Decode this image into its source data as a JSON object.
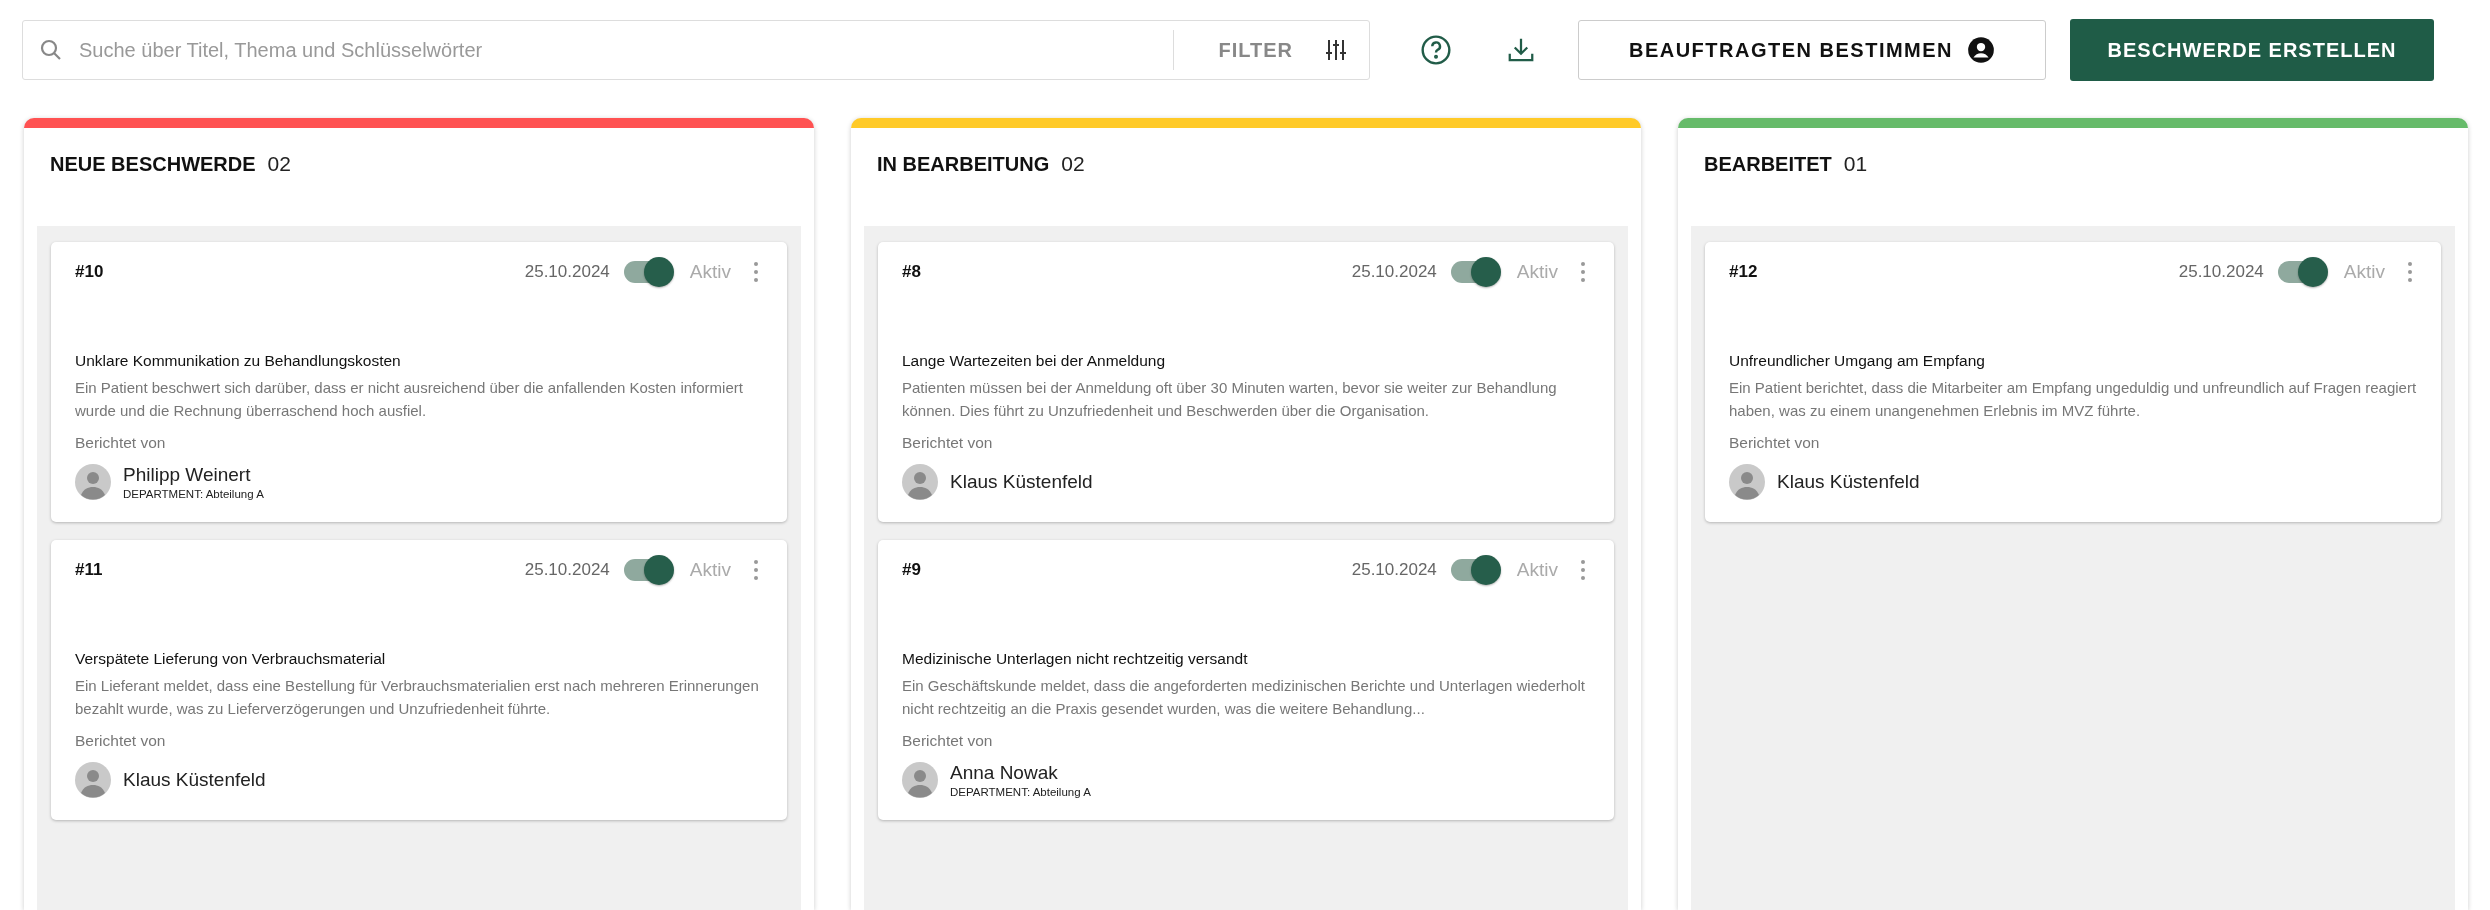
{
  "toolbar": {
    "search": {
      "placeholder": "Suche über Titel, Thema und Schlüsselwörter"
    },
    "filter_label": "FILTER",
    "assign_button": "BEAUFTRAGTEN BESTIMMEN",
    "create_button": "BESCHWERDE ERSTELLEN"
  },
  "columns": [
    {
      "title": "NEUE BESCHWERDE",
      "count": "02",
      "color": "#ff5252",
      "cards": [
        {
          "id": "#10",
          "date": "25.10.2024",
          "active": true,
          "status": "Aktiv",
          "title": "Unklare Kommunikation zu Behandlungskosten",
          "description": "Ein Patient beschwert sich darüber, dass er nicht ausreichend über die anfallenden Kosten informiert wurde und die Rechnung überraschend hoch ausfiel.",
          "reported_label": "Berichtet von",
          "reporter": "Philipp Weinert",
          "department": "DEPARTMENT: Abteilung A"
        },
        {
          "id": "#11",
          "date": "25.10.2024",
          "active": true,
          "status": "Aktiv",
          "title": "Verspätete Lieferung von Verbrauchsmaterial",
          "description": "Ein Lieferant meldet, dass eine Bestellung für Verbrauchsmaterialien erst nach mehreren Erinnerungen bezahlt wurde, was zu Lieferverzögerungen und Unzufriedenheit führte.",
          "reported_label": "Berichtet von",
          "reporter": "Klaus Küstenfeld"
        }
      ]
    },
    {
      "title": "IN BEARBEITUNG",
      "count": "02",
      "color": "#ffca28",
      "cards": [
        {
          "id": "#8",
          "date": "25.10.2024",
          "active": true,
          "status": "Aktiv",
          "title": "Lange Wartezeiten bei der Anmeldung",
          "description": "Patienten müssen bei der Anmeldung oft über 30 Minuten warten, bevor sie weiter zur Behandlung können. Dies führt zu Unzufriedenheit und Beschwerden über die Organisation.",
          "reported_label": "Berichtet von",
          "reporter": "Klaus Küstenfeld"
        },
        {
          "id": "#9",
          "date": "25.10.2024",
          "active": true,
          "status": "Aktiv",
          "title": "Medizinische Unterlagen nicht rechtzeitig versandt",
          "description": "Ein Geschäftskunde meldet, dass die angeforderten medizinischen Berichte und Unterlagen wiederholt nicht rechtzeitig an die Praxis gesendet wurden, was die weitere Behandlung...",
          "reported_label": "Berichtet von",
          "reporter": "Anna Nowak",
          "department": "DEPARTMENT: Abteilung A"
        }
      ]
    },
    {
      "title": "BEARBEITET",
      "count": "01",
      "color": "#66bb6a",
      "cards": [
        {
          "id": "#12",
          "date": "25.10.2024",
          "active": true,
          "status": "Aktiv",
          "title": "Unfreundlicher Umgang am Empfang",
          "description": "Ein Patient berichtet, dass die Mitarbeiter am Empfang ungeduldig und unfreundlich auf Fragen reagiert haben, was zu einem unangenehmen Erlebnis im MVZ führte.",
          "reported_label": "Berichtet von",
          "reporter": "Klaus Küstenfeld"
        }
      ]
    }
  ]
}
